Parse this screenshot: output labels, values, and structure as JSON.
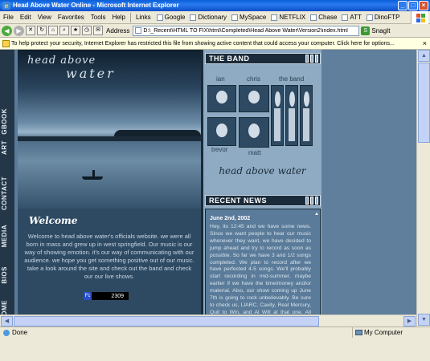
{
  "window": {
    "title": "Head Above Water Online - Microsoft Internet Explorer"
  },
  "menu": [
    "File",
    "Edit",
    "View",
    "Favorites",
    "Tools",
    "Help"
  ],
  "links": {
    "label": "Links",
    "items": [
      "Google",
      "Dictionary",
      "MySpace",
      "NETFLIX",
      "Chase",
      "ATT",
      "DinoFTP"
    ]
  },
  "toolbar": {
    "address_label": "Address",
    "address_value": "D:\\_Recent\\HTML TO FIX\\html\\Completed\\Head Above Water\\Version2\\index.html",
    "snagit_label": "SnagIt"
  },
  "infobar": {
    "text": "To help protect your security, Internet Explorer has restricted this file from showing active content that could access your computer. Click here for options..."
  },
  "nav": [
    "HOME",
    "BIOS",
    "MEDIA",
    "CONTACT",
    "ART",
    "GBOOK"
  ],
  "hero": {
    "title_line1": "head above",
    "title_line2": "water"
  },
  "welcome": {
    "title": "Welcome",
    "text": "Welcome to head above water's officials website. we were all born in mass and grew up in west springfield. Our music is our way of showing emotion. it's our way of communicating with our audience. we hope you get something positive out of our music. take a look around the site and check out the band and check our our live shows.",
    "counter_value": "2309"
  },
  "band": {
    "heading": "THE BAND",
    "members_top": [
      "ian",
      "chris",
      "the band"
    ],
    "members_bottom": [
      "trevor",
      "matt"
    ],
    "signature": "head above water"
  },
  "news": {
    "heading": "RECENT NEWS",
    "date": "June 2nd, 2002",
    "text": "Hey, its 12:45 and we have some news. Since we want people to hear our music whenever they want, we have decided to jump ahead and try to record as soon as possible. So far we have 3 and 1/2 songs completed. We plan to record after we have perfected 4-5 songs. We'll probably start recording in mid-summer, maybe earlier if we have the time/money and/or material. Also, our show coming up June 7th is going to rock unbelievably. Be sure to check us, LIARC, Cavity, Real Mercury, Quit to Win, and Al Will at that one. All excellent bands, with awesome awesome live performances. Hope to see you there -"
  },
  "status": {
    "left": "Done",
    "zone": "My Computer"
  }
}
